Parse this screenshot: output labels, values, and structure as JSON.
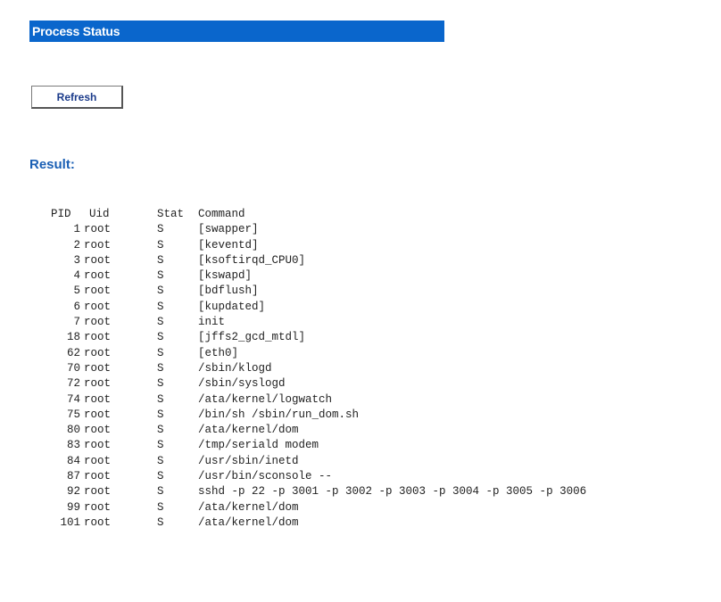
{
  "header": {
    "title": "Process Status"
  },
  "toolbar": {
    "refresh_label": "Refresh"
  },
  "result": {
    "label": "Result:"
  },
  "table": {
    "columns": [
      "PID",
      "Uid",
      "Stat",
      "Command"
    ],
    "rows": [
      {
        "pid": "1",
        "uid": "root",
        "stat": "S",
        "command": "[swapper]"
      },
      {
        "pid": "2",
        "uid": "root",
        "stat": "S",
        "command": "[keventd]"
      },
      {
        "pid": "3",
        "uid": "root",
        "stat": "S",
        "command": "[ksoftirqd_CPU0]"
      },
      {
        "pid": "4",
        "uid": "root",
        "stat": "S",
        "command": "[kswapd]"
      },
      {
        "pid": "5",
        "uid": "root",
        "stat": "S",
        "command": "[bdflush]"
      },
      {
        "pid": "6",
        "uid": "root",
        "stat": "S",
        "command": "[kupdated]"
      },
      {
        "pid": "7",
        "uid": "root",
        "stat": "S",
        "command": "init"
      },
      {
        "pid": "18",
        "uid": "root",
        "stat": "S",
        "command": "[jffs2_gcd_mtdl]"
      },
      {
        "pid": "62",
        "uid": "root",
        "stat": "S",
        "command": "[eth0]"
      },
      {
        "pid": "70",
        "uid": "root",
        "stat": "S",
        "command": "/sbin/klogd"
      },
      {
        "pid": "72",
        "uid": "root",
        "stat": "S",
        "command": "/sbin/syslogd"
      },
      {
        "pid": "74",
        "uid": "root",
        "stat": "S",
        "command": "/ata/kernel/logwatch"
      },
      {
        "pid": "75",
        "uid": "root",
        "stat": "S",
        "command": "/bin/sh /sbin/run_dom.sh"
      },
      {
        "pid": "80",
        "uid": "root",
        "stat": "S",
        "command": "/ata/kernel/dom"
      },
      {
        "pid": "83",
        "uid": "root",
        "stat": "S",
        "command": "/tmp/seriald modem"
      },
      {
        "pid": "84",
        "uid": "root",
        "stat": "S",
        "command": "/usr/sbin/inetd"
      },
      {
        "pid": "87",
        "uid": "root",
        "stat": "S",
        "command": "/usr/bin/sconsole --"
      },
      {
        "pid": "92",
        "uid": "root",
        "stat": "S",
        "command": "sshd -p 22 -p 3001 -p 3002 -p 3003 -p 3004 -p 3005 -p 3006"
      },
      {
        "pid": "99",
        "uid": "root",
        "stat": "S",
        "command": "/ata/kernel/dom"
      },
      {
        "pid": "101",
        "uid": "root",
        "stat": "S",
        "command": "/ata/kernel/dom"
      }
    ]
  },
  "colors": {
    "title_bar_bg": "#0a66cc",
    "title_bar_text": "#ffffff",
    "result_label": "#1a5fb4",
    "button_text": "#1a3a8a"
  }
}
